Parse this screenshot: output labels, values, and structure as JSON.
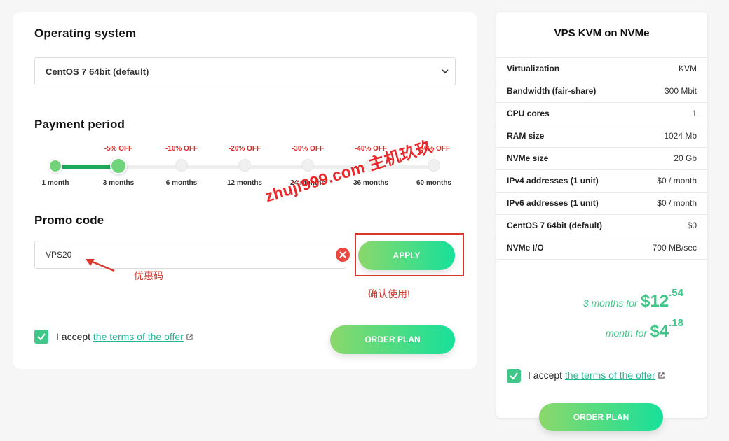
{
  "os": {
    "title": "Operating system",
    "selected": "CentOS 7 64bit (default)"
  },
  "payment": {
    "title": "Payment period",
    "periods": [
      {
        "label": "1 month",
        "discount": "",
        "state": "done"
      },
      {
        "label": "3 months",
        "discount": "-5% OFF",
        "state": "active"
      },
      {
        "label": "6 months",
        "discount": "-10% OFF",
        "state": "idle"
      },
      {
        "label": "12 months",
        "discount": "-20% OFF",
        "state": "idle"
      },
      {
        "label": "24 months",
        "discount": "-30% OFF",
        "state": "idle"
      },
      {
        "label": "36 months",
        "discount": "-40% OFF",
        "state": "idle"
      },
      {
        "label": "60 months",
        "discount": "-50% OFF",
        "state": "idle"
      }
    ]
  },
  "promo": {
    "title": "Promo code",
    "value": "VPS20",
    "apply_label": "APPLY"
  },
  "annotations": {
    "promo_note": "优惠码",
    "apply_note": "确认使用!",
    "watermark": "zhuji999.com 主机玖玖"
  },
  "accept": {
    "prefix": "I accept",
    "link": "the terms of the offer"
  },
  "order_label": "ORDER PLAN",
  "plan": {
    "title": "VPS KVM on NVMe",
    "specs": [
      {
        "name": "Virtualization",
        "value": "KVM"
      },
      {
        "name": "Bandwidth (fair-share)",
        "value": "300 Mbit"
      },
      {
        "name": "CPU cores",
        "value": "1"
      },
      {
        "name": "RAM size",
        "value": "1024 Mb"
      },
      {
        "name": "NVMe size",
        "value": "20 Gb"
      },
      {
        "name": "IPv4 addresses (1 unit)",
        "value": "$0 / month"
      },
      {
        "name": "IPv6 addresses (1 unit)",
        "value": "$0 / month"
      },
      {
        "name": "CentOS 7 64bit (default)",
        "value": "$0"
      },
      {
        "name": "NVMe I/O",
        "value": "700 MB/sec"
      }
    ],
    "total_label": "3 months for",
    "total_major": "$12",
    "total_minor": ".54",
    "monthly_label": "month for",
    "monthly_major": "$4",
    "monthly_minor": ".18"
  },
  "colors": {
    "accent_green": "#3ec788",
    "discount_red": "#e02b2b",
    "annotation_red": "#d8372d"
  }
}
